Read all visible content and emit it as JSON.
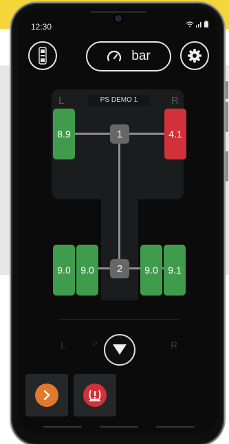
{
  "status_bar": {
    "time": "12:30"
  },
  "header": {
    "unit": "bar"
  },
  "vehicle": {
    "name": "PS DEMO 1",
    "left_label": "L",
    "right_label": "R",
    "axles": [
      {
        "number": "1",
        "tires": {
          "left": "8.9",
          "right": "4.1"
        }
      },
      {
        "number": "2",
        "tires": {
          "left_outer": "9.0",
          "left_inner": "9.0",
          "right_inner": "9.0",
          "right_outer": "9.1"
        }
      }
    ]
  },
  "second_vehicle": {
    "left_label": "L",
    "right_label": "R",
    "name_partial": "P        6"
  },
  "colors": {
    "ok": "#3f9c4c",
    "alarm": "#d1323a",
    "orange": "#e07a2c",
    "red": "#d1323a"
  },
  "icons": [
    "vehicle-icon",
    "speedometer-icon",
    "gear-icon",
    "chevron-down-icon",
    "chevron-right-icon",
    "tpms-icon"
  ]
}
